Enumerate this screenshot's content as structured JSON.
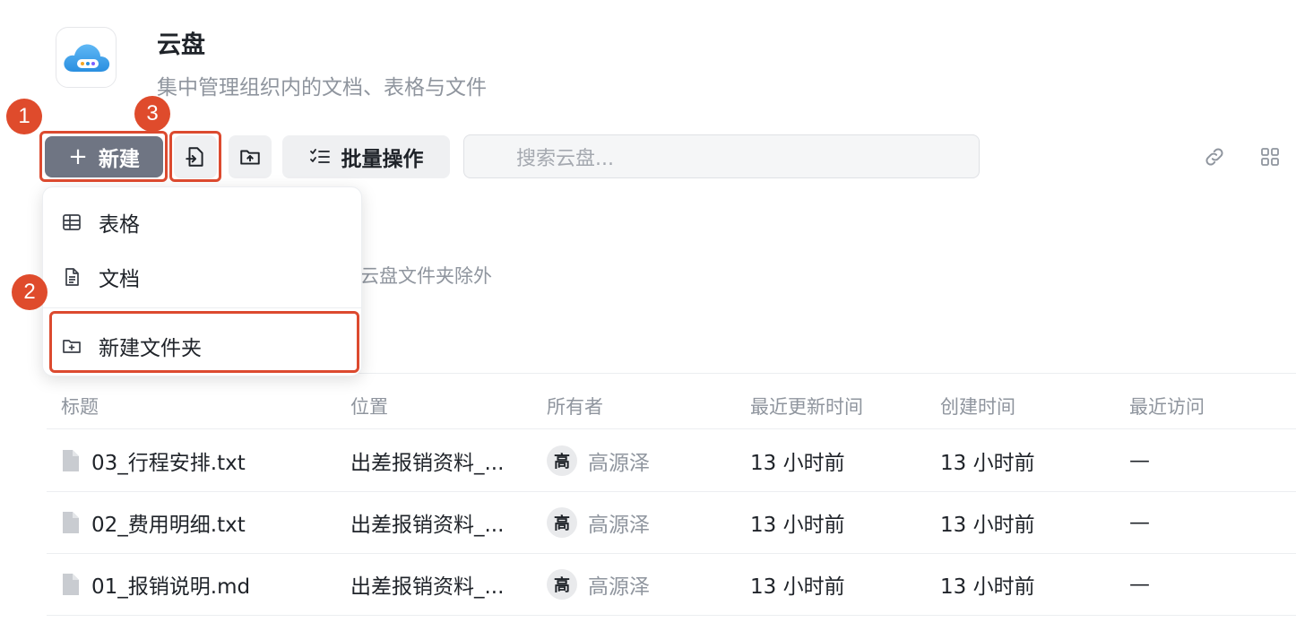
{
  "header": {
    "title": "云盘",
    "subtitle": "集中管理组织内的文档、表格与文件"
  },
  "toolbar": {
    "new_label": "新建",
    "batch_label": "批量操作",
    "search_placeholder": "搜索云盘..."
  },
  "hint_text": "云盘文件夹除外",
  "dropdown": {
    "items": [
      {
        "label": "表格",
        "icon": "table-icon"
      },
      {
        "label": "文档",
        "icon": "document-icon"
      },
      {
        "label": "新建文件夹",
        "icon": "folder-plus-icon"
      }
    ]
  },
  "table": {
    "columns": [
      "标题",
      "位置",
      "所有者",
      "最近更新时间",
      "创建时间",
      "最近访问"
    ],
    "rows": [
      {
        "title": "03_行程安排.txt",
        "location": "出差报销资料_...",
        "owner_initial": "高",
        "owner": "高源泽",
        "updated": "13 小时前",
        "created": "13 小时前",
        "visited": "—"
      },
      {
        "title": "02_费用明细.txt",
        "location": "出差报销资料_...",
        "owner_initial": "高",
        "owner": "高源泽",
        "updated": "13 小时前",
        "created": "13 小时前",
        "visited": "—"
      },
      {
        "title": "01_报销说明.md",
        "location": "出差报销资料_...",
        "owner_initial": "高",
        "owner": "高源泽",
        "updated": "13 小时前",
        "created": "13 小时前",
        "visited": "—"
      }
    ]
  },
  "annotations": [
    "1",
    "2",
    "3"
  ],
  "colors": {
    "accent_dark": "#6f7583",
    "highlight": "#dc4a2f",
    "muted_text": "#8f959e"
  }
}
